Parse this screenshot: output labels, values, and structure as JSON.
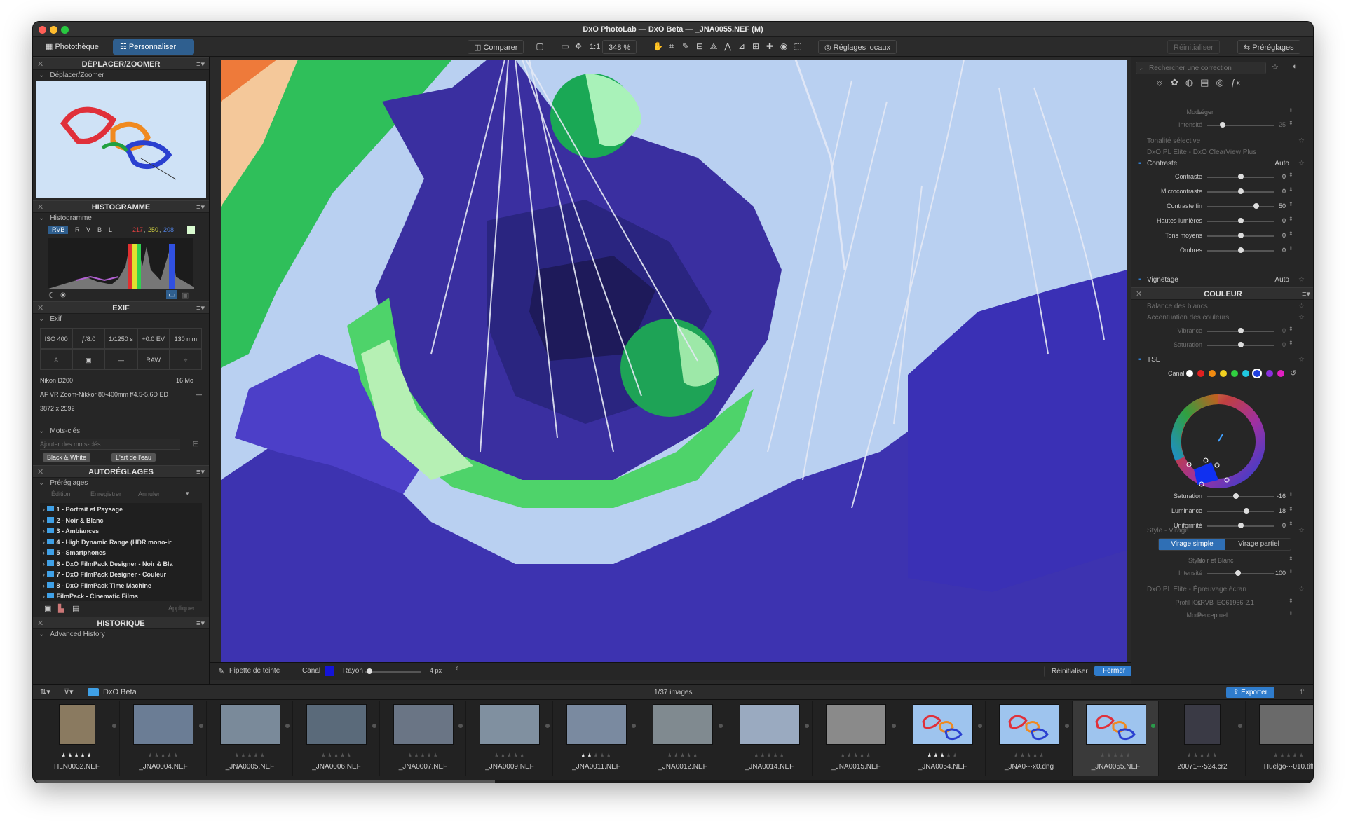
{
  "window": {
    "title": "DxO PhotoLab — DxO Beta — _JNA0055.NEF (M)"
  },
  "toolbar": {
    "tab_library": "Photothèque",
    "tab_customize": "Personnaliser",
    "compare": "Comparer",
    "one_to_one": "1:1",
    "zoom": "348 %",
    "local_adjust": "Réglages locaux",
    "reset": "Réinitialiser",
    "presets": "Préréglages"
  },
  "left": {
    "move_zoom": {
      "title": "DÉPLACER/ZOOMER",
      "sub": "Déplacer/Zoomer"
    },
    "histogram": {
      "title": "HISTOGRAMME",
      "sub": "Histogramme",
      "channels": [
        "RVB",
        "R",
        "V",
        "B",
        "L"
      ],
      "rgb_r": "217",
      "rgb_g": "250",
      "rgb_b": "208"
    },
    "exif": {
      "title": "EXIF",
      "sub": "Exif",
      "iso": "ISO 400",
      "aperture": "ƒ/8.0",
      "shutter": "1/1250 s",
      "ev": "+0.0 EV",
      "focal": "130 mm",
      "mode": "A",
      "flash": "—",
      "format": "RAW",
      "camera": "Nikon D200",
      "size_mp": "16 Mo",
      "lens": "AF VR Zoom-Nikkor 80-400mm f/4.5-5.6D ED",
      "lens_dash": "—",
      "dimensions": "3872 x 2592"
    },
    "keywords": {
      "sub": "Mots-clés",
      "placeholder": "Ajouter des mots-clés",
      "tags": [
        "Black & White",
        "L'art de l'eau"
      ]
    },
    "autopresets": {
      "title": "AUTORÉGLAGES",
      "sub": "Préréglages",
      "actions": [
        "Édition",
        "Enregistrer",
        "Annuler"
      ],
      "items": [
        "1 - Portrait et Paysage",
        "2 - Noir & Blanc",
        "3 - Ambiances",
        "4 - High Dynamic Range (HDR mono-ir",
        "5 - Smartphones",
        "6 - DxO FilmPack Designer - Noir & Bla",
        "7 - DxO FilmPack Designer - Couleur",
        "8 - DxO FilmPack Time Machine",
        "FilmPack - Cinematic Films"
      ],
      "apply": "Appliquer"
    },
    "history": {
      "title": "HISTORIQUE",
      "sub": "Advanced History"
    }
  },
  "viewer_bar": {
    "eyedropper": "Pipette de teinte",
    "channel": "Canal",
    "radius": "Rayon",
    "radius_val": "4 px",
    "reset": "Réinitialiser",
    "close": "Fermer"
  },
  "right": {
    "search_placeholder": "Rechercher une correction",
    "mode_label": "Mode",
    "mode_val": "Léger",
    "intensity_label": "Intensité",
    "intensity_val": "25",
    "selective_tone": "Tonalité sélective",
    "clearview": "DxO PL Elite - DxO ClearView Plus",
    "contrast": {
      "title": "Contraste",
      "auto": "Auto",
      "rows": [
        {
          "label": "Contraste",
          "val": "0"
        },
        {
          "label": "Microcontraste",
          "val": "0"
        },
        {
          "label": "Contraste fin",
          "val": "50"
        },
        {
          "label": "Hautes lumières",
          "val": "0"
        },
        {
          "label": "Tons moyens",
          "val": "0"
        },
        {
          "label": "Ombres",
          "val": "0"
        }
      ]
    },
    "vignetting": "Vignetage",
    "vignetting_auto": "Auto",
    "color_title": "COULEUR",
    "white_balance": "Balance des blancs",
    "color_accent": "Accentuation des couleurs",
    "vibrance": {
      "label": "Vibrance",
      "val": "0"
    },
    "saturation0": {
      "label": "Saturation",
      "val": "0"
    },
    "tsl": "TSL",
    "canal": "Canal",
    "hsl_rows": [
      {
        "label": "Saturation",
        "val": "-16"
      },
      {
        "label": "Luminance",
        "val": "18"
      },
      {
        "label": "Uniformité",
        "val": "0"
      }
    ],
    "style_toning": "Style - Virage",
    "toning_simple": "Virage simple",
    "toning_partial": "Virage partiel",
    "style_label": "Style",
    "style_val": "Noir et Blanc",
    "toning_intensity_label": "Intensité",
    "toning_intensity_val": "100",
    "softproof": "DxO PL Elite - Épreuvage écran",
    "icc_label": "Profil ICC",
    "icc_val": "sRVB IEC61966-2.1",
    "proof_mode_label": "Mode",
    "proof_mode_val": "Perceptuel"
  },
  "filmstrip": {
    "folder": "DxO Beta",
    "count": "1/37 images",
    "export": "Exporter",
    "items": [
      {
        "name": "HLN0032.NEF",
        "stars": "★★★★★"
      },
      {
        "name": "_JNA0004.NEF",
        "stars": "★★★★★"
      },
      {
        "name": "_JNA0005.NEF",
        "stars": "★★★★★"
      },
      {
        "name": "_JNA0006.NEF",
        "stars": "★★★★★"
      },
      {
        "name": "_JNA0007.NEF",
        "stars": "★★★★★"
      },
      {
        "name": "_JNA0009.NEF",
        "stars": "★★★★★"
      },
      {
        "name": "_JNA0011.NEF",
        "stars": "★★★★★"
      },
      {
        "name": "_JNA0012.NEF",
        "stars": "★★★★★"
      },
      {
        "name": "_JNA0014.NEF",
        "stars": "★★★★★"
      },
      {
        "name": "_JNA0015.NEF",
        "stars": "★★★★★"
      },
      {
        "name": "_JNA0054.NEF",
        "stars": "★★★★★"
      },
      {
        "name": "_JNA0···x0.dng",
        "stars": "★★★★★"
      },
      {
        "name": "_JNA0055.NEF",
        "stars": "★★★★★"
      },
      {
        "name": "20071···524.cr2",
        "stars": "★★★★★"
      },
      {
        "name": "Huelgo···010.tiff",
        "stars": "★★★★★"
      }
    ],
    "ratings": [
      5,
      0,
      0,
      0,
      0,
      0,
      2,
      0,
      0,
      0,
      3,
      0,
      0,
      0,
      0
    ]
  }
}
